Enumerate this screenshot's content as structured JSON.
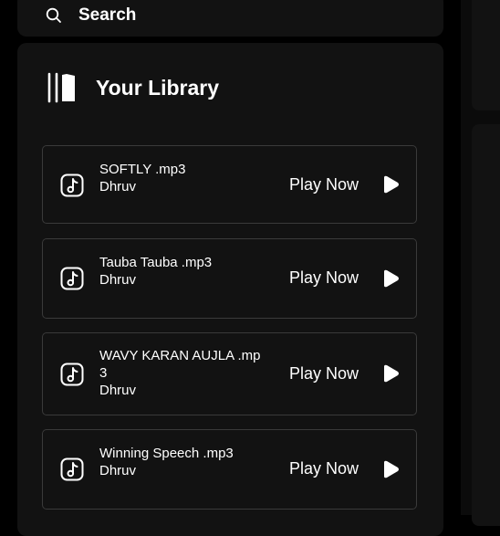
{
  "search": {
    "label": "Search",
    "icon": "search-icon"
  },
  "library": {
    "title": "Your Library",
    "icon": "library-icon",
    "tracks": [
      {
        "title": "SOFTLY .mp3",
        "artist": "Dhruv",
        "action": "Play Now"
      },
      {
        "title": "Tauba Tauba .mp3",
        "artist": "Dhruv",
        "action": "Play Now"
      },
      {
        "title": "WAVY KARAN AUJLA .mp3",
        "artist": "Dhruv",
        "action": "Play Now"
      },
      {
        "title": "Winning Speech .mp3",
        "artist": "Dhruv",
        "action": "Play Now"
      }
    ]
  },
  "colors": {
    "background": "#000000",
    "panel": "#121212",
    "border": "#3a3a3a",
    "text": "#ffffff"
  }
}
